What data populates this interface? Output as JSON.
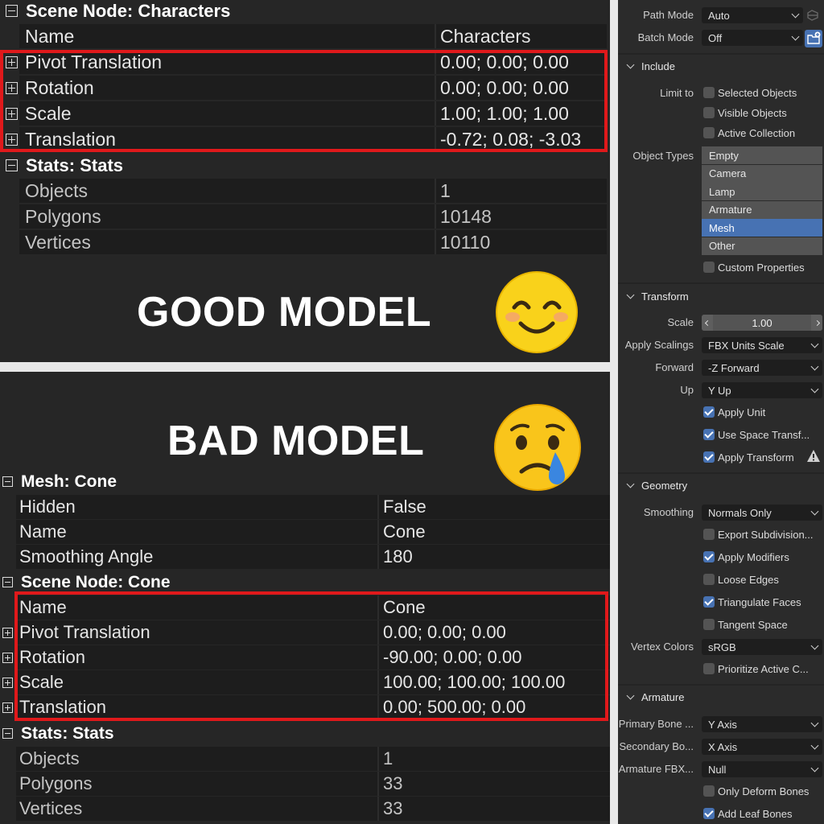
{
  "good_panel": {
    "scene_header": "Scene Node: Characters",
    "column_headers": {
      "name": "Name",
      "value": "Characters"
    },
    "transform_rows": [
      {
        "name": "Pivot Translation",
        "value": "0.00; 0.00; 0.00"
      },
      {
        "name": "Rotation",
        "value": "0.00; 0.00; 0.00"
      },
      {
        "name": "Scale",
        "value": "1.00; 1.00; 1.00"
      },
      {
        "name": "Translation",
        "value": "-0.72; 0.08; -3.03"
      }
    ],
    "stats_header": "Stats: Stats",
    "stats_rows": [
      {
        "name": "Objects",
        "value": "1"
      },
      {
        "name": "Polygons",
        "value": "10148"
      },
      {
        "name": "Vertices",
        "value": "10110"
      }
    ],
    "label": "GOOD MODEL",
    "emoji": "smiling-face-icon"
  },
  "bad_panel": {
    "label": "BAD MODEL",
    "emoji": "crying-face-icon",
    "mesh_header": "Mesh: Cone",
    "mesh_rows": [
      {
        "name": "Hidden",
        "value": "False"
      },
      {
        "name": "Name",
        "value": "Cone"
      },
      {
        "name": "Smoothing Angle",
        "value": "180"
      }
    ],
    "scene_header": "Scene Node: Cone",
    "scene_rows": [
      {
        "name": "Name",
        "value": "Cone"
      },
      {
        "name": "Pivot Translation",
        "value": "0.00; 0.00; 0.00"
      },
      {
        "name": "Rotation",
        "value": "-90.00; 0.00; 0.00"
      },
      {
        "name": "Scale",
        "value": "100.00; 100.00; 100.00"
      },
      {
        "name": "Translation",
        "value": "0.00; 500.00; 0.00"
      }
    ],
    "stats_header": "Stats: Stats",
    "stats_rows": [
      {
        "name": "Objects",
        "value": "1"
      },
      {
        "name": "Polygons",
        "value": "33"
      },
      {
        "name": "Vertices",
        "value": "33"
      }
    ]
  },
  "export_panel": {
    "path_mode": {
      "label": "Path Mode",
      "value": "Auto"
    },
    "batch_mode": {
      "label": "Batch Mode",
      "value": "Off"
    },
    "include": {
      "title": "Include",
      "limit_to_label": "Limit to",
      "limit_options": [
        {
          "label": "Selected Objects",
          "checked": false
        },
        {
          "label": "Visible Objects",
          "checked": false
        },
        {
          "label": "Active Collection",
          "checked": false
        }
      ],
      "object_types_label": "Object Types",
      "object_types": [
        {
          "label": "Empty",
          "selected": false
        },
        {
          "label": "Camera",
          "selected": false
        },
        {
          "label": "Lamp",
          "selected": false
        },
        {
          "label": "Armature",
          "selected": false
        },
        {
          "label": "Mesh",
          "selected": true
        },
        {
          "label": "Other",
          "selected": false
        }
      ],
      "custom_properties": {
        "label": "Custom Properties",
        "checked": false
      }
    },
    "transform": {
      "title": "Transform",
      "scale": {
        "label": "Scale",
        "value": "1.00"
      },
      "apply_scalings": {
        "label": "Apply Scalings",
        "value": "FBX Units Scale"
      },
      "forward": {
        "label": "Forward",
        "value": "-Z Forward"
      },
      "up": {
        "label": "Up",
        "value": "Y Up"
      },
      "apply_unit": {
        "label": "Apply Unit",
        "checked": true
      },
      "use_space_transform": {
        "label": "Use Space Transf...",
        "checked": true
      },
      "apply_transform": {
        "label": "Apply Transform",
        "checked": true
      }
    },
    "geometry": {
      "title": "Geometry",
      "smoothing": {
        "label": "Smoothing",
        "value": "Normals Only"
      },
      "export_subdivision": {
        "label": "Export Subdivision...",
        "checked": false
      },
      "apply_modifiers": {
        "label": "Apply Modifiers",
        "checked": true
      },
      "loose_edges": {
        "label": "Loose Edges",
        "checked": false
      },
      "triangulate_faces": {
        "label": "Triangulate Faces",
        "checked": true
      },
      "tangent_space": {
        "label": "Tangent Space",
        "checked": false
      },
      "vertex_colors": {
        "label": "Vertex Colors",
        "value": "sRGB"
      },
      "prioritize_active": {
        "label": "Prioritize Active C...",
        "checked": false
      }
    },
    "armature": {
      "title": "Armature",
      "primary_bone": {
        "label": "Primary Bone ...",
        "value": "Y Axis"
      },
      "secondary_bone": {
        "label": "Secondary Bo...",
        "value": "X Axis"
      },
      "armature_fbx": {
        "label": "Armature FBX...",
        "value": "Null"
      },
      "only_deform_bones": {
        "label": "Only Deform Bones",
        "checked": false
      },
      "add_leaf_bones": {
        "label": "Add Leaf Bones",
        "checked": true
      }
    }
  },
  "colors": {
    "highlight": "#e0191b",
    "accent": "#4772b3",
    "panel_bg": "#262626",
    "cell_bg": "#1d1d1d"
  }
}
